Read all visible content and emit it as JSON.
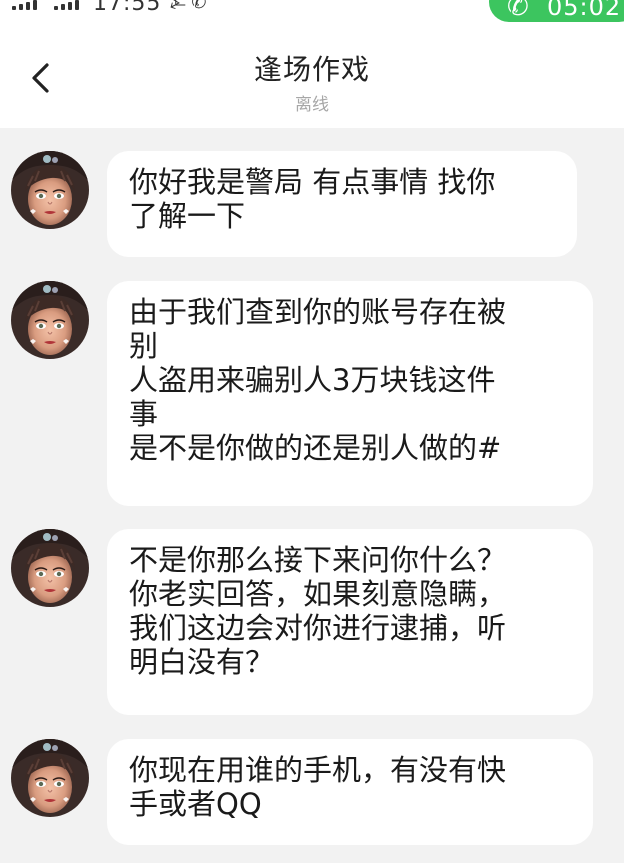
{
  "status_bar": {
    "time": "17:55",
    "icons": "⍼ ✆",
    "call_icon": "phone-icon",
    "call_timer": "05:02",
    "call_color": "#3cc55f"
  },
  "header": {
    "title": "逢场作戏",
    "status": "离线",
    "back_icon": "chevron-left-icon"
  },
  "messages": [
    {
      "text": "你好我是警局 有点事情 找你\n了解一下"
    },
    {
      "text": "由于我们查到你的账号存在被\n别\n人盗用来骗别人3万块钱这件\n事\n是不是你做的还是别人做的#"
    },
    {
      "text": "不是你那么接下来问你什么？\n你老实回答，如果刻意隐瞒，\n我们这边会对你进行逮捕，听\n明白没有？"
    },
    {
      "text": "你现在用谁的手机，有没有快\n手或者QQ"
    }
  ],
  "colors": {
    "chat_background": "#f2f2f2",
    "bubble": "#ffffff"
  }
}
